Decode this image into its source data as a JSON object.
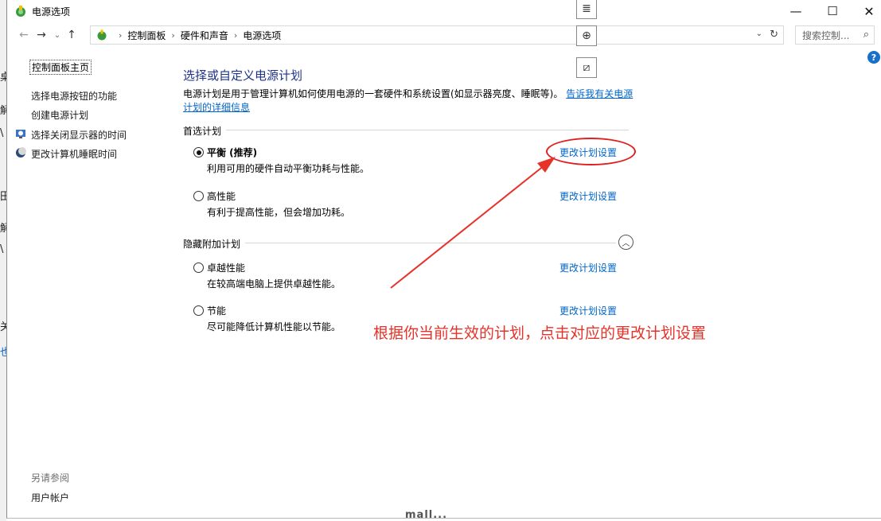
{
  "window": {
    "title": "电源选项",
    "controls": {
      "minimize": "—",
      "maximize": "☐",
      "close": "✕"
    }
  },
  "navbar": {
    "back": "←",
    "forward": "→",
    "recent": "⌄",
    "up": "↑",
    "breadcrumb": [
      "控制面板",
      "硬件和声音",
      "电源选项"
    ],
    "separator": "›",
    "dropdown": "⌄",
    "refresh": "↻",
    "search_placeholder": "搜索控制...",
    "search_icon": "⌕"
  },
  "float_toolbar": {
    "icon1": "≣",
    "icon2": "⊕",
    "icon3": "⧄"
  },
  "help": "?",
  "left_panel": {
    "home": "控制面板主页",
    "links": [
      "选择电源按钮的功能",
      "创建电源计划",
      "选择关闭显示器的时间",
      "更改计算机睡眠时间"
    ],
    "see_also_title": "另请参阅",
    "see_also_link": "用户帐户"
  },
  "main": {
    "title": "选择或自定义电源计划",
    "description": "电源计划是用于管理计算机如何使用电源的一套硬件和系统设置(如显示器亮度、睡眠等)。",
    "description_link": "告诉我有关电源计划的详细信息",
    "preferred_group": "首选计划",
    "hidden_group": "隐藏附加计划",
    "collapse_icon": "︿",
    "plans": [
      {
        "name": "平衡 (推荐)",
        "desc": "利用可用的硬件自动平衡功耗与性能。",
        "link": "更改计划设置",
        "checked": true
      },
      {
        "name": "高性能",
        "desc": "有利于提高性能，但会增加功耗。",
        "link": "更改计划设置",
        "checked": false
      },
      {
        "name": "卓越性能",
        "desc": "在较高端电脑上提供卓越性能。",
        "link": "更改计划设置",
        "checked": false
      },
      {
        "name": "节能",
        "desc": "尽可能降低计算机性能以节能。",
        "link": "更改计划设置",
        "checked": false
      }
    ]
  },
  "annotation": {
    "text": "根据你当前生效的计划，点击对应的更改计划设置",
    "color": "#e5332a"
  },
  "background_fragments": [
    "桌",
    "解",
    "\\",
    "田",
    "解",
    "\\",
    "关",
    "也"
  ],
  "bottom_fragment": "mall..."
}
